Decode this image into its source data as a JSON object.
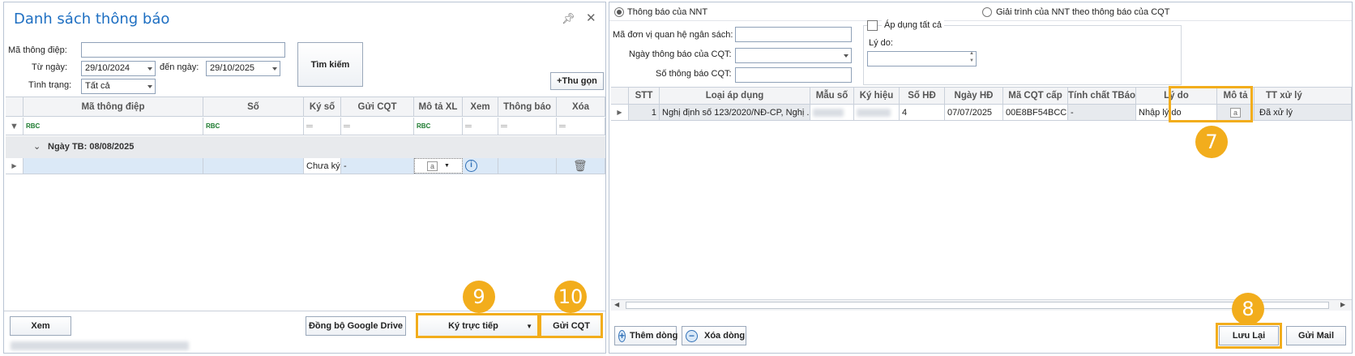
{
  "left_window": {
    "title": "Danh sách thông báo",
    "filters": {
      "ma_thong_diep_label": "Mã thông điệp:",
      "ma_thong_diep_value": "",
      "tu_ngay_label": "Từ ngày:",
      "tu_ngay_value": "29/10/2024",
      "den_ngay_label": "đến ngày:",
      "den_ngay_value": "29/10/2025",
      "tinh_trang_label": "Tình trạng:",
      "tinh_trang_value": "Tất cả"
    },
    "search_button": "Tìm kiếm",
    "collapse_button": "+Thu gọn",
    "columns": [
      "Mã thông điệp",
      "Số",
      "Ký số",
      "Gửi CQT",
      "Mô tả XL",
      "Xem",
      "Thông báo",
      "Xóa"
    ],
    "filter_row_glyph": "RBC",
    "group_label": "Ngày TB: 08/08/2025",
    "row": {
      "ky_so": "Chưa ký",
      "gui_cqt": "-"
    },
    "footer": {
      "view_button": "Xem",
      "sync_button": "Đồng bộ Google Drive",
      "sign_button": "Ký trực tiếp",
      "send_button": "Gửi CQT"
    },
    "badges": {
      "sign": "9",
      "send": "10"
    }
  },
  "right_window": {
    "radio_nnt": "Thông báo của NNT",
    "radio_giai_trinh": "Giải trình của NNT theo thông báo của CQT",
    "ma_don_vi_label": "Mã đơn vị quan hệ ngân sách:",
    "ngay_tb_label": "Ngày thông báo của CQT:",
    "so_tb_label": "Số thông báo CQT:",
    "apply_all_label": "Áp dụng tất cả",
    "ly_do_label": "Lý do:",
    "columns": [
      "STT",
      "Loại áp dụng",
      "Mẫu số",
      "Ký hiệu",
      "Số HĐ",
      "Ngày HĐ",
      "Mã CQT cấp",
      "Tính chất TBáo",
      "Lý do",
      "Mô tả",
      "TT xử lý"
    ],
    "row": {
      "stt": "1",
      "loai_ap_dung": "Nghị định số 123/2020/NĐ-CP, Nghị ...",
      "so_hd": "4",
      "ngay_hd": "07/07/2025",
      "ma_cqt": "00E8BF54BCC...",
      "tinh_chat": "-",
      "ly_do": "Nhập lý do",
      "tt_xu_ly": "Đã xử lý"
    },
    "footer": {
      "add_row": "Thêm dòng",
      "delete_row": "Xóa dòng",
      "save": "Lưu Lại",
      "send_mail": "Gửi Mail"
    },
    "badges": {
      "ly_do": "7",
      "save": "8"
    }
  },
  "colors": {
    "accent": "#f2ad1c",
    "title": "#1e6fc2",
    "selected_row": "#dbe9f7"
  }
}
